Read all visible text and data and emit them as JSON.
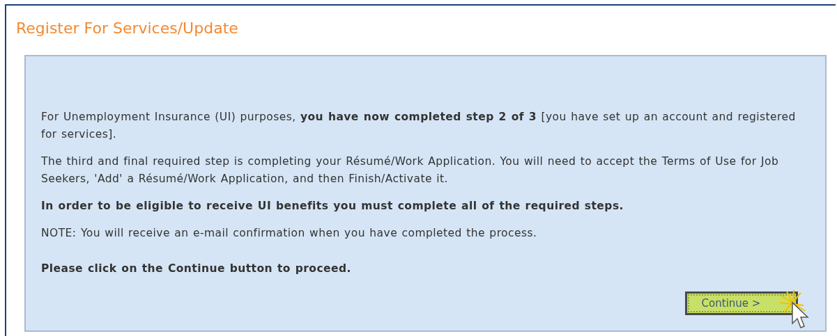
{
  "page": {
    "title": "Register For Services/Update"
  },
  "paragraphs": [
    {
      "text": "For Unemployment Insurance (UI) purposes, **you have now completed step 2 of 3** [you have set up an account and registered for services].",
      "bold": false
    },
    {
      "text": "The third and final required step is completing your Résumé/Work Application. You will need to accept the Terms of Use for Job Seekers, 'Add' a Résumé/Work Application, and then Finish/Activate it.",
      "bold": false
    },
    {
      "text": "In order to be eligible to receive UI benefits you must complete all of the required steps.",
      "bold": true
    },
    {
      "text": "NOTE: You will receive an e-mail confirmation when you have completed the process.",
      "bold": false
    },
    {
      "text": "Please click on the Continue button to proceed.",
      "bold": true
    }
  ],
  "continue_button": {
    "label": "Continue >"
  }
}
